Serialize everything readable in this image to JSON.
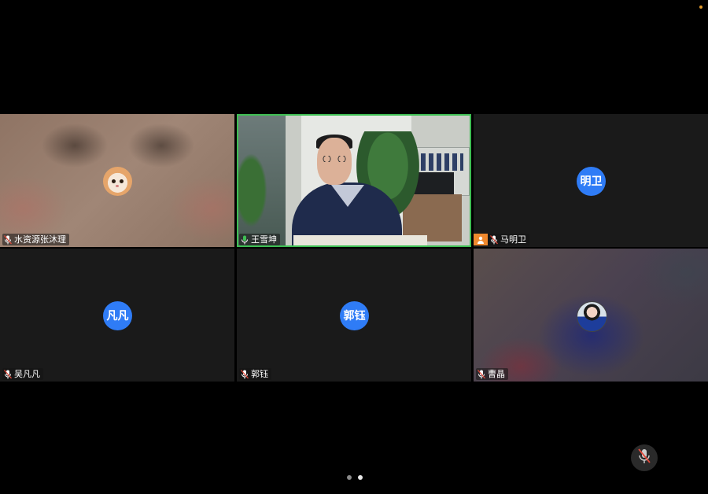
{
  "participants": [
    {
      "name": "水资源张沐理",
      "avatar": "cat-photo",
      "muted": true
    },
    {
      "name": "王雪坤",
      "avatar": "video",
      "speaking": true
    },
    {
      "name": "马明卫",
      "avatar_text": "明卫",
      "badge": "person-icon",
      "muted": true
    },
    {
      "name": "吴凡凡",
      "avatar_text": "凡凡",
      "muted": true
    },
    {
      "name": "郭钰",
      "avatar_text": "郭钰",
      "muted": true
    },
    {
      "name": "曹晶",
      "avatar": "girl-photo",
      "muted": true
    }
  ],
  "pager": {
    "pages": 2,
    "current": 2
  },
  "colors": {
    "avatar_blue": "#2f7cf6",
    "speaking_green": "#3fbf54",
    "badge_orange": "#f0892e",
    "status_dot": "#e29a2b"
  }
}
